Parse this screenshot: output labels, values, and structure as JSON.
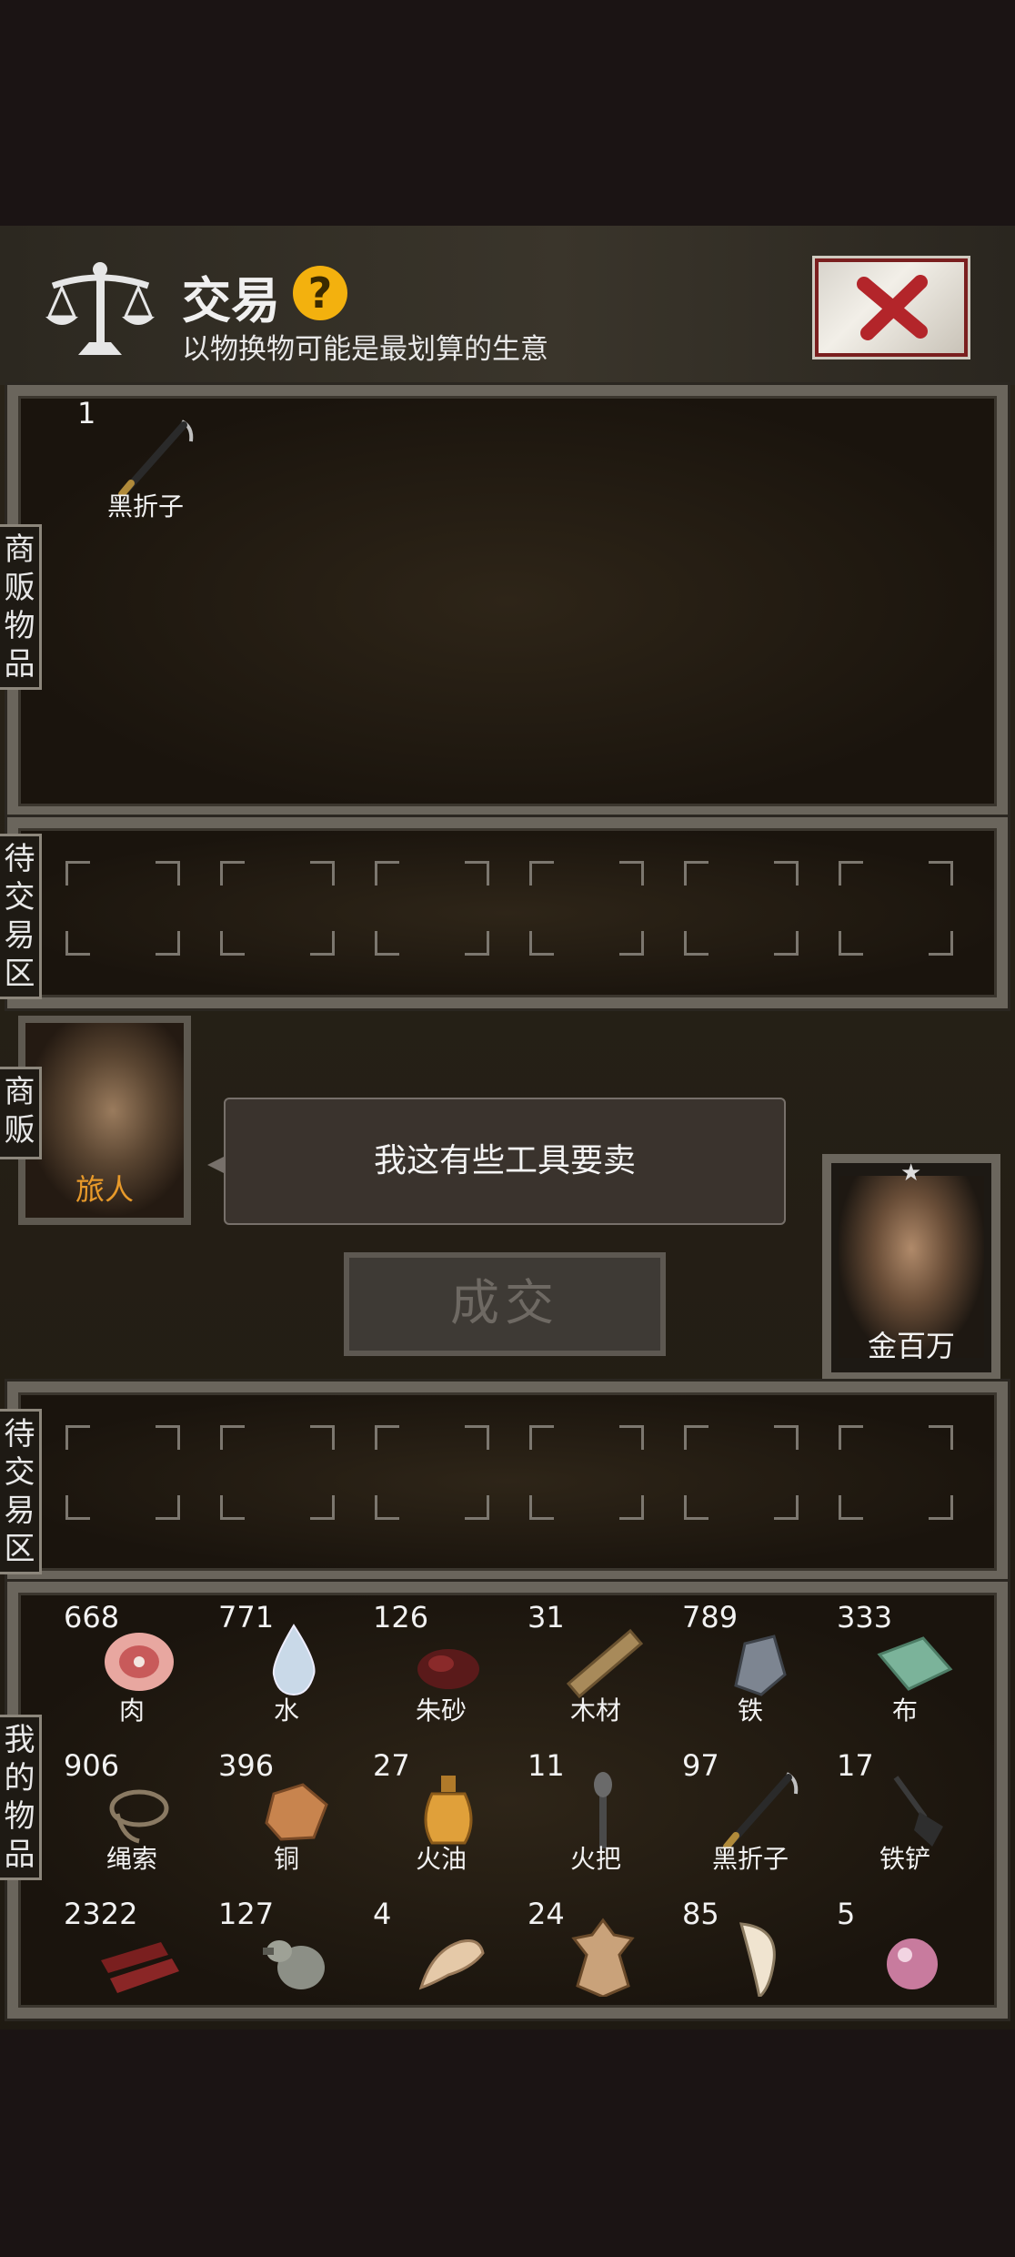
{
  "header": {
    "title": "交易",
    "help_label": "?",
    "subtitle": "以物换物可能是最划算的生意"
  },
  "labels": {
    "vendor_items": "商贩物品",
    "vendor_pending": "待交易区",
    "vendor_tag": "商贩",
    "my_pending": "待交易区",
    "my_items": "我的物品"
  },
  "vendor": {
    "name": "旅人",
    "speech": "我这有些工具要卖",
    "items": [
      {
        "count": "1",
        "name": "黑折子",
        "icon": "black-pick-icon"
      }
    ]
  },
  "player": {
    "name": "金百万"
  },
  "deal_button": "成交",
  "my_items": [
    {
      "count": "668",
      "name": "肉",
      "icon": "meat-icon"
    },
    {
      "count": "771",
      "name": "水",
      "icon": "water-drop-icon"
    },
    {
      "count": "126",
      "name": "朱砂",
      "icon": "cinnabar-icon"
    },
    {
      "count": "31",
      "name": "木材",
      "icon": "wood-plank-icon"
    },
    {
      "count": "789",
      "name": "铁",
      "icon": "iron-ore-icon"
    },
    {
      "count": "333",
      "name": "布",
      "icon": "cloth-icon"
    },
    {
      "count": "906",
      "name": "绳索",
      "icon": "rope-icon"
    },
    {
      "count": "396",
      "name": "铜",
      "icon": "copper-ore-icon"
    },
    {
      "count": "27",
      "name": "火油",
      "icon": "oil-bottle-icon"
    },
    {
      "count": "11",
      "name": "火把",
      "icon": "torch-icon"
    },
    {
      "count": "97",
      "name": "黑折子",
      "icon": "black-pick-icon"
    },
    {
      "count": "17",
      "name": "铁铲",
      "icon": "shovel-icon"
    },
    {
      "count": "2322",
      "name": "",
      "icon": "jerky-icon"
    },
    {
      "count": "127",
      "name": "",
      "icon": "gourd-icon"
    },
    {
      "count": "4",
      "name": "",
      "icon": "bone-icon"
    },
    {
      "count": "24",
      "name": "",
      "icon": "pelt-icon"
    },
    {
      "count": "85",
      "name": "",
      "icon": "fang-icon"
    },
    {
      "count": "5",
      "name": "",
      "icon": "pearl-icon"
    }
  ],
  "colors": {
    "vendor_name": "#e89a2a",
    "help_badge": "#f3b10e",
    "close_x": "#b3252a"
  }
}
